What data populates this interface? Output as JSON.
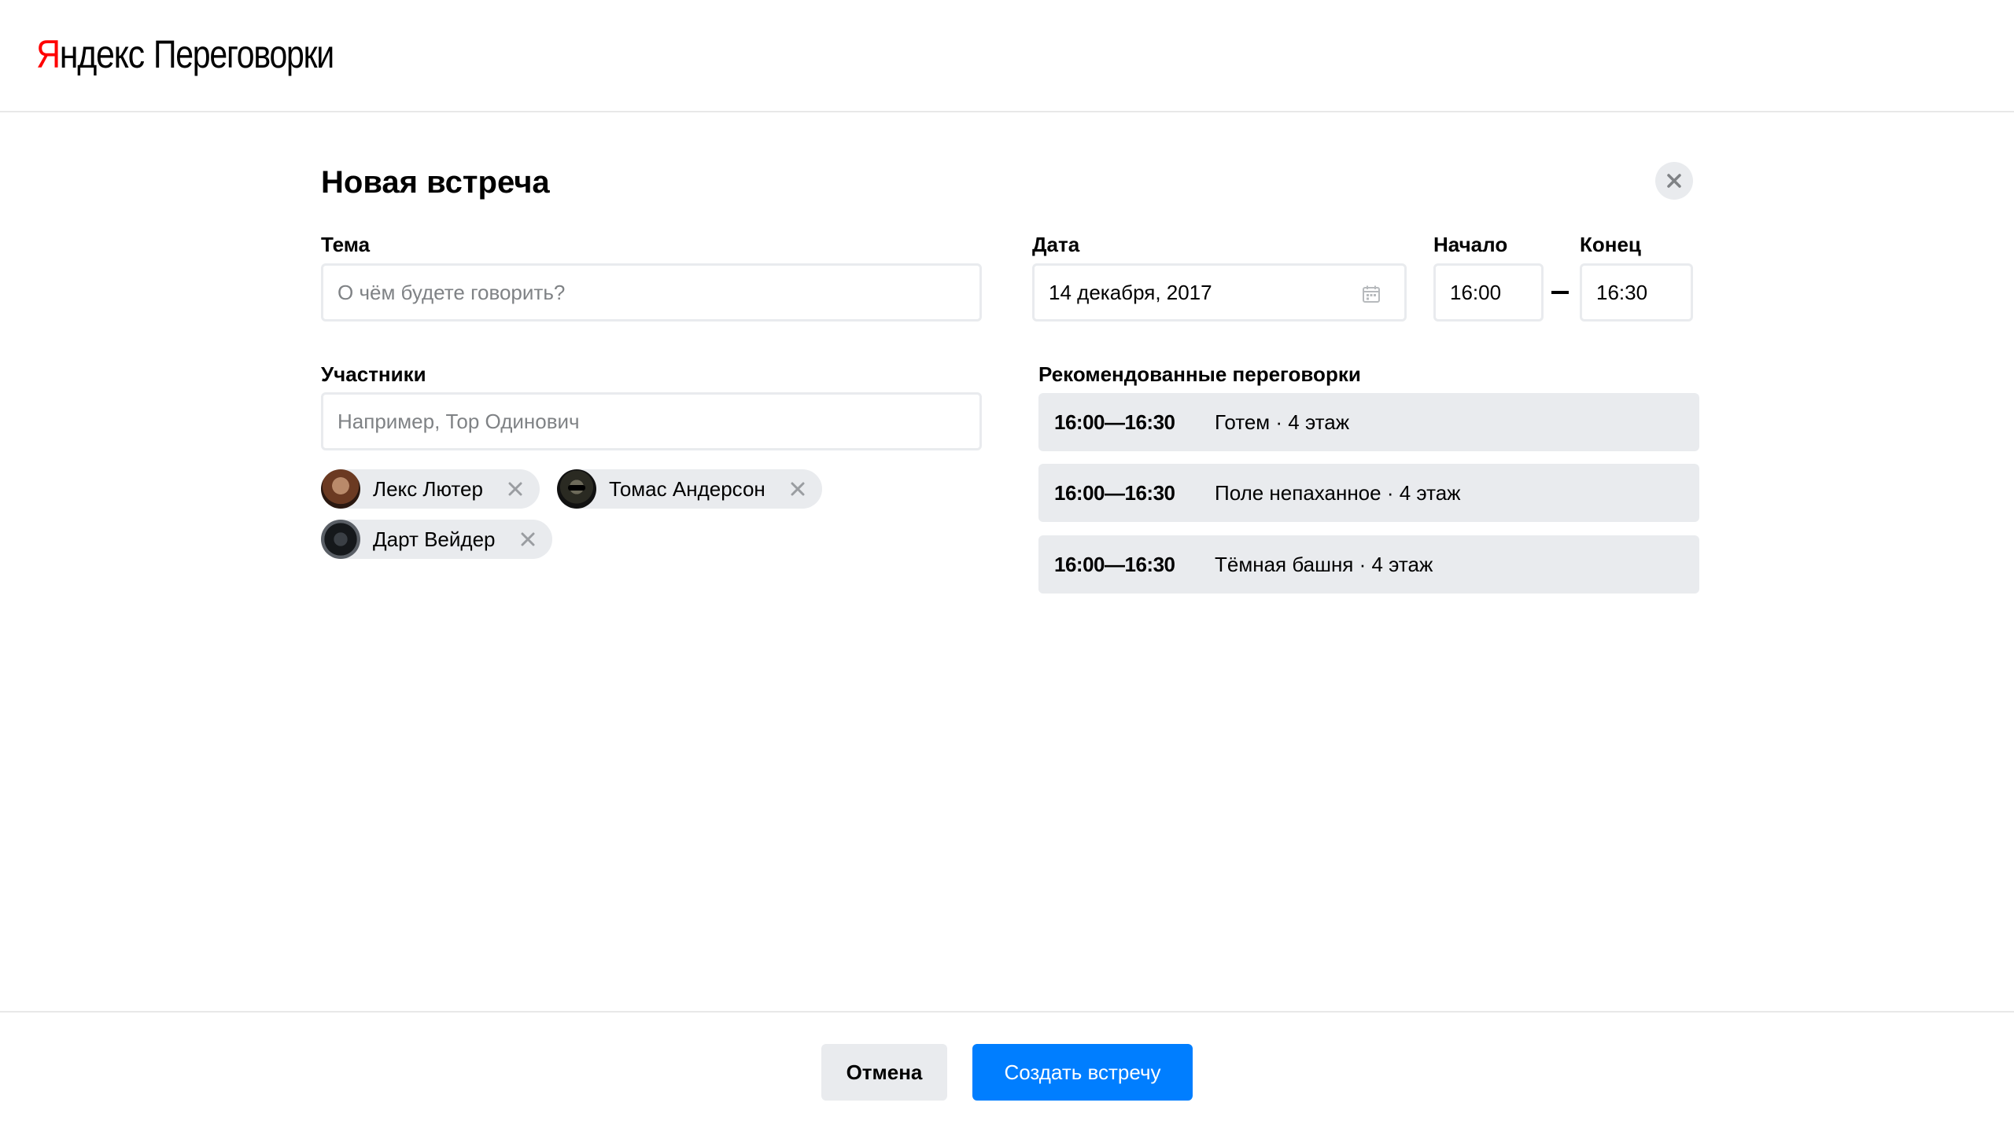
{
  "header": {
    "logo_brand_first": "Я",
    "logo_brand_rest": "ндекс",
    "logo_product": "Переговорки"
  },
  "page": {
    "title": "Новая встреча",
    "close_icon": "close-icon"
  },
  "form": {
    "topic": {
      "label": "Тема",
      "placeholder": "О чём будете говорить?",
      "value": ""
    },
    "date": {
      "label": "Дата",
      "value": "14 декабря, 2017",
      "icon": "calendar-icon"
    },
    "start": {
      "label": "Начало",
      "value": "16:00"
    },
    "end": {
      "label": "Конец",
      "value": "16:30"
    },
    "participants": {
      "label": "Участники",
      "placeholder": "Например, Тор Одинович",
      "value": "",
      "items": [
        {
          "name": "Лекс Лютер"
        },
        {
          "name": "Томас Андерсон"
        },
        {
          "name": "Дарт Вейдер"
        }
      ]
    },
    "recommended": {
      "label": "Рекомендованные переговорки",
      "items": [
        {
          "time": "16:00—16:30",
          "room": "Готем · 4 этаж"
        },
        {
          "time": "16:00—16:30",
          "room": "Поле непаханное · 4 этаж"
        },
        {
          "time": "16:00—16:30",
          "room": "Тёмная башня · 4 этаж"
        }
      ]
    }
  },
  "footer": {
    "cancel_label": "Отмена",
    "create_label": "Создать встречу"
  },
  "colors": {
    "accent": "#007eff",
    "brand_red": "#ff0000",
    "surface": "#e9ebee",
    "border": "#e9ebee"
  }
}
